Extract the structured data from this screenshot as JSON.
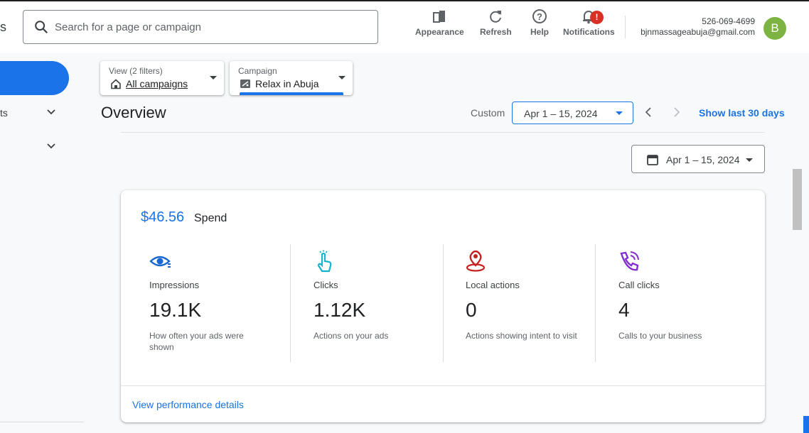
{
  "header": {
    "cut_nav_letter": "s",
    "search_placeholder": "Search for a page or campaign",
    "tools": [
      {
        "label": "Appearance",
        "icon": "appearance-icon"
      },
      {
        "label": "Refresh",
        "icon": "refresh-icon"
      },
      {
        "label": "Help",
        "icon": "help-icon"
      },
      {
        "label": "Notifications",
        "icon": "bell-icon",
        "badge": "!"
      }
    ],
    "account_id": "526-069-4699",
    "account_email": "bjnmassageabuja@gmail.com",
    "avatar_letter": "B"
  },
  "sidebar": {
    "items": [
      {
        "label": "ts"
      },
      {
        "label": ""
      }
    ]
  },
  "filters": {
    "view_label": "View (2 filters)",
    "view_value": "All campaigns",
    "campaign_label": "Campaign",
    "campaign_value": "Relax in Abuja"
  },
  "overview": {
    "title": "Overview",
    "custom_label": "Custom",
    "date_range": "Apr 1 – 15, 2024",
    "show_last": "Show last 30 days",
    "date_button": "Apr 1 – 15, 2024"
  },
  "card": {
    "spend_value": "$46.56",
    "spend_label": "Spend",
    "metrics": [
      {
        "name": "Impressions",
        "value": "19.1K",
        "desc": "How often your ads were shown",
        "icon": "eye-icon",
        "color": "#1967d2"
      },
      {
        "name": "Clicks",
        "value": "1.12K",
        "desc": "Actions on your ads",
        "icon": "tap-icon",
        "color": "#12b5cb"
      },
      {
        "name": "Local actions",
        "value": "0",
        "desc": "Actions showing intent to visit",
        "icon": "location-pin-icon",
        "color": "#c5221f"
      },
      {
        "name": "Call clicks",
        "value": "4",
        "desc": "Calls to your business",
        "icon": "phone-call-icon",
        "color": "#8430ce"
      }
    ],
    "link": "View performance details"
  },
  "colors": {
    "accent": "#1a73e8",
    "alert": "#d93025",
    "avatar": "#7cb342"
  }
}
